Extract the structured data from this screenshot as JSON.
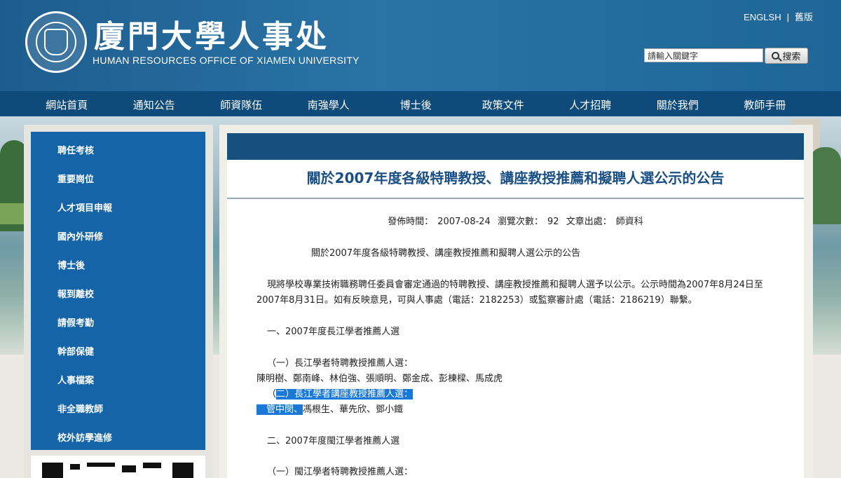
{
  "header": {
    "title_cn": "廈門大學人事处",
    "title_en": "HUMAN RESOURCES OFFICE OF XIAMEN UNIVERSITY",
    "english_link": "ENGLSH",
    "separator": "|",
    "old_version_link": "舊版",
    "search_placeholder": "請輸入關鍵字",
    "search_button": "搜索"
  },
  "nav": {
    "items": [
      "網站首頁",
      "通知公告",
      "師資隊伍",
      "南強學人",
      "博士後",
      "政策文件",
      "人才招聘",
      "關於我們",
      "教師手冊"
    ]
  },
  "sidebar": {
    "items": [
      "聘任考核",
      "重要崗位",
      "人才項目申報",
      "國內外研修",
      "博士後",
      "報到離校",
      "請假考勤",
      "幹部保健",
      "人事檔案",
      "非全職教師",
      "校外訪學進修"
    ]
  },
  "article": {
    "title": "關於2007年度各級特聘教授、講座教授推薦和擬聘人選公示的公告",
    "meta": {
      "publish_label": "發佈時間：",
      "publish_date": "2007-08-24",
      "views_label": "瀏覽次數：",
      "views": "92",
      "source_label": "文章出處：",
      "source": "師資科"
    },
    "heading": "關於2007年度各級特聘教授、講座教授推薦和擬聘人選公示的公告",
    "para1_line1": "現將學校專業技術職務聘任委員會審定通過的特聘教授、講座教授推薦和擬聘人選予以公示。公示時間為2007年8月24日至",
    "para1_line2": "2007年8月31日。如有反映意見，可與人事處（電話：2182253）或監察審計處（電話：2186219）聯繫。",
    "section1": "一、2007年度長江學者推薦人選",
    "sub1": "（一）長江學者特聘教授推薦人選：",
    "sub1_names": "陳明樹、鄭南峰、林伯強、張順明、鄭金成、彭棟樑、馬成虎",
    "sub2_prefix": "（",
    "sub2_selected": "二）長江學者講座教授推薦人選：",
    "sub2_names_selected": "管中閔、",
    "sub2_names_rest": "馮根生、華先欣、鄧小鐵",
    "section2": "二、2007年度閩江學者推薦人選",
    "sub3": "（一）閩江學者特聘教授推薦人選："
  }
}
